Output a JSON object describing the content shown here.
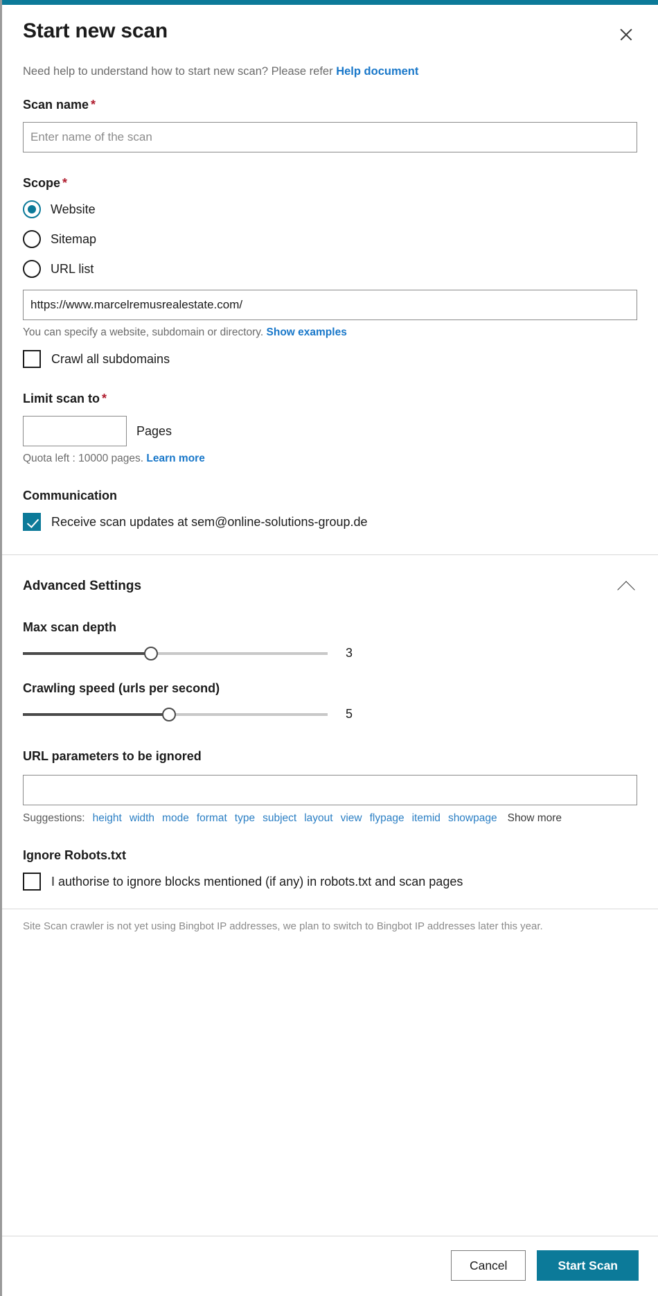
{
  "accent_color": "#0c7a99",
  "link_color": "#1877c9",
  "required_color": "#b01c2e",
  "header": {
    "title": "Start new scan",
    "close_icon": "close-icon"
  },
  "help": {
    "text": "Need help to understand how to start new scan? Please refer",
    "link_label": "Help document"
  },
  "scan_name": {
    "label": "Scan name",
    "required_marker": "*",
    "placeholder": "Enter name of the scan",
    "value": ""
  },
  "scope": {
    "label": "Scope",
    "required_marker": "*",
    "options": [
      {
        "label": "Website",
        "checked": true
      },
      {
        "label": "Sitemap",
        "checked": false
      },
      {
        "label": "URL list",
        "checked": false
      }
    ],
    "url_value": "https://www.marcelremusrealestate.com/",
    "hint_text": "You can specify a website, subdomain or directory.",
    "hint_link": "Show examples",
    "subdomains_label": "Crawl all subdomains",
    "subdomains_checked": false
  },
  "limit_scan": {
    "label": "Limit scan to",
    "required_marker": "*",
    "value": "",
    "unit": "Pages",
    "quota_text": "Quota left : 10000 pages.",
    "quota_link": "Learn more"
  },
  "communication": {
    "label": "Communication",
    "checkbox_label": "Receive scan updates at sem@online-solutions-group.de",
    "checked": true
  },
  "advanced": {
    "title": "Advanced Settings",
    "chevron_icon": "chevron-up-icon",
    "expanded": true,
    "max_depth": {
      "label": "Max scan depth",
      "value": 3,
      "percent": 42
    },
    "crawl_speed": {
      "label": "Crawling speed (urls per second)",
      "value": 5,
      "percent": 48
    },
    "url_params": {
      "label": "URL parameters to be ignored",
      "value": "",
      "suggestions_label": "Suggestions:",
      "suggestions": [
        "height",
        "width",
        "mode",
        "format",
        "type",
        "subject",
        "layout",
        "view",
        "flypage",
        "itemid",
        "showpage"
      ],
      "show_more_label": "Show more"
    },
    "robots": {
      "label": "Ignore Robots.txt",
      "checkbox_label": "I authorise to ignore blocks mentioned (if any) in robots.txt and scan pages",
      "checked": false
    }
  },
  "bottom_note": "Site Scan crawler is not yet using Bingbot IP addresses, we plan to switch to Bingbot IP addresses later this year.",
  "footer": {
    "cancel_label": "Cancel",
    "submit_label": "Start Scan"
  }
}
